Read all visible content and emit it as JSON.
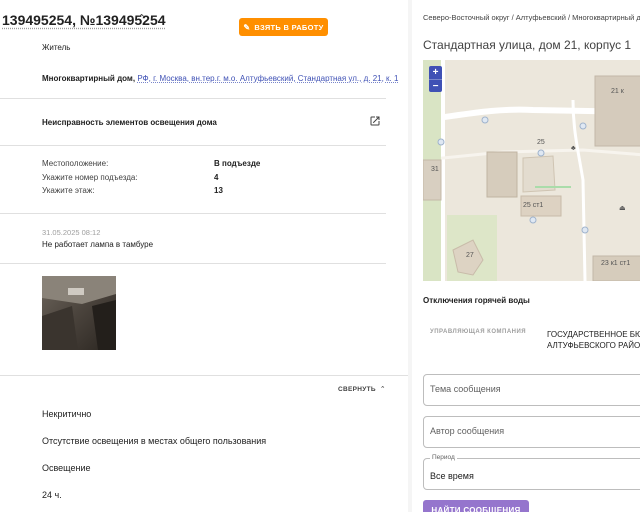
{
  "ticket": {
    "title": "139495254, №139495254",
    "take_button": "ВЗЯТЬ В РАБОТУ",
    "author_type": "Житель",
    "address_prefix": "Многоквартирный дом,",
    "address_link": "РФ, г. Москва, вн.тер.г. м.о. Алтуфьевский, Стандартная ул., д. 21, к. 1",
    "problem": "Неисправность элементов освещения дома",
    "fields": [
      {
        "label": "Местоположение:",
        "value": "В подъезде"
      },
      {
        "label": "Укажите номер подъезда:",
        "value": "4"
      },
      {
        "label": "Укажите этаж:",
        "value": "13"
      }
    ],
    "timestamp": "31.05.2025 08:12",
    "message": "Не работает лампа в тамбуре",
    "collapse_label": "СВЕРНУТЬ",
    "details": [
      "Некритично",
      "Отсутствие освещения в местах общего пользования",
      "Освещение",
      "24 ч."
    ]
  },
  "object": {
    "breadcrumbs": "Северо-Восточный округ / Алтуфьевский / Многоквартирный дом",
    "address_title": "Стандартная улица, дом 21, корпус 1",
    "map": {
      "zoom_in": "+",
      "zoom_out": "−",
      "labels": [
        "31",
        "27",
        "25 ст1",
        "25",
        "23 к1 ст1",
        "21 к"
      ]
    },
    "hot_water_title": "Отключения горячей воды",
    "management_label": "УПРАВЛЯЮЩАЯ КОМПАНИЯ",
    "management_value_1": "ГОСУДАРСТВЕННОЕ БЮДЖ",
    "management_value_2": "АЛТУФЬЕВСКОГО РАЙОНА"
  },
  "search": {
    "subject_placeholder": "Тема сообщения",
    "author_placeholder": "Автор сообщения",
    "period_label": "Период",
    "period_value": "Все время",
    "find_button": "НАЙТИ СООБЩЕНИЯ"
  },
  "colors": {
    "accent": "#3f51b5",
    "take_button": "#ff8f00",
    "find_button": "#9575cd"
  }
}
